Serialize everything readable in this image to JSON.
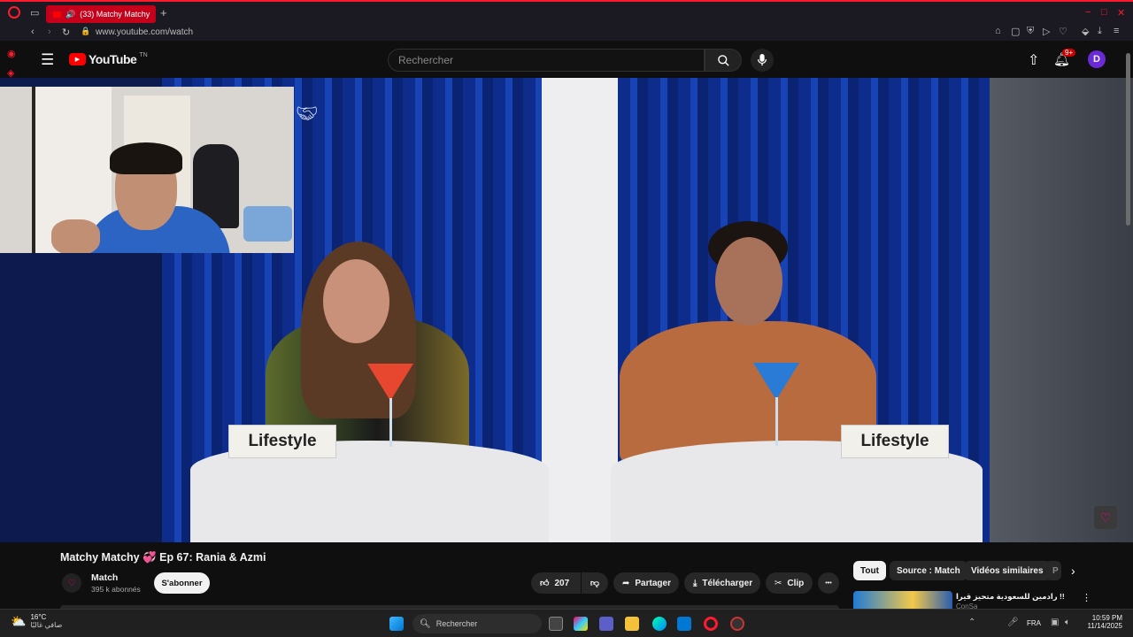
{
  "browser": {
    "tab_title": "(33) Matchy Matchy",
    "new_tab": "+",
    "url": "www.youtube.com/watch"
  },
  "youtube": {
    "logo_text": "YouTube",
    "logo_region": "TN",
    "search_placeholder": "Rechercher",
    "notifications_badge": "9+",
    "avatar_letter": "D"
  },
  "video": {
    "sign_left": "Lifestyle",
    "sign_right": "Lifestyle"
  },
  "meta": {
    "title": "Matchy Matchy 💞 Ep 67: Rania & Azmi",
    "channel": "Match",
    "subscribers": "395 k abonnés",
    "subscribe": "S'abonner",
    "likes": "207",
    "share": "Partager",
    "download": "Télécharger",
    "clip": "Clip",
    "more": "•••"
  },
  "chips": [
    "Tout",
    "Source : Match",
    "Vidéos similaires",
    "P"
  ],
  "recommendation": {
    "title": "!! رادمين للسعودية متحيز قيرا",
    "channel": "ConSa"
  },
  "taskbar": {
    "weather_temp": "16°C",
    "weather_desc": "صافي غالبًا",
    "search": "Rechercher",
    "lang": "FRA",
    "time": "10:59 PM",
    "date": "11/14/2025"
  },
  "colors": {
    "opera_red": "#ff1b2d",
    "youtube_red": "#ff0000",
    "avatar_purple": "#6a2bd6"
  }
}
